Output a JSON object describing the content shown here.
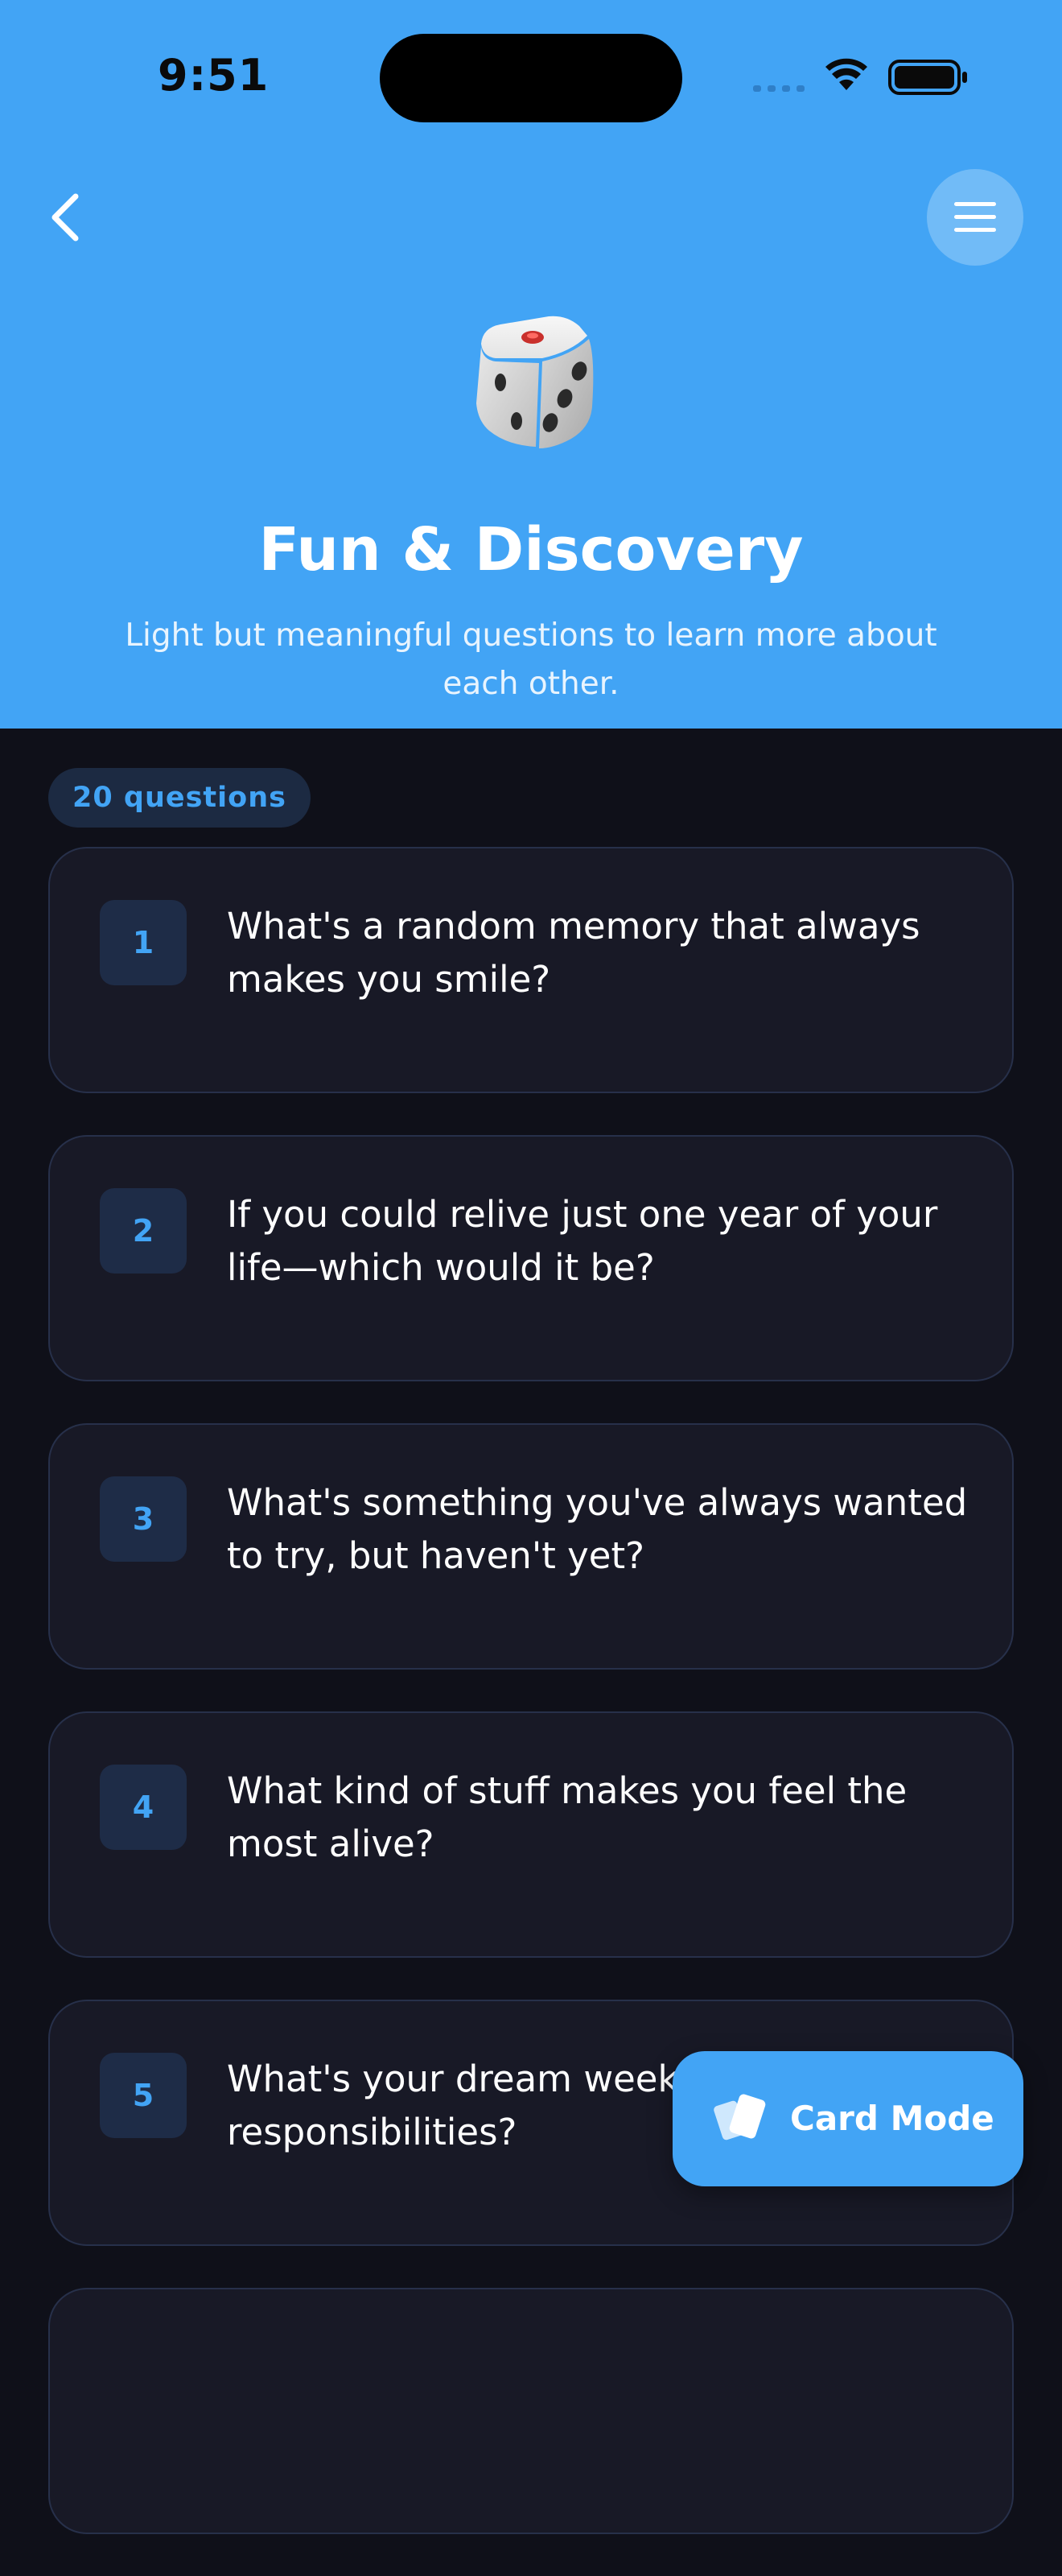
{
  "status_bar": {
    "time": "9:51"
  },
  "header": {
    "title": "Fun & Discovery",
    "subtitle": "Light but meaningful questions to learn more about each other.",
    "icons": {
      "back": "chevron-left-icon",
      "menu": "hamburger-menu-icon",
      "category": "dice-icon"
    },
    "background_color": "#42a4f5"
  },
  "question_count_label": "20 questions",
  "questions": [
    {
      "number": "1",
      "text": "What's a random memory that always makes you smile?"
    },
    {
      "number": "2",
      "text": "If you could relive just one year of your life—which would it be?"
    },
    {
      "number": "3",
      "text": "What's something you've always wanted to try, but haven't yet?"
    },
    {
      "number": "4",
      "text": "What kind of stuff makes you feel the most alive?"
    },
    {
      "number": "5",
      "text": "What's your dream weekend without responsibilities?"
    }
  ],
  "fab": {
    "label": "Card Mode",
    "icon": "cards-icon"
  },
  "colors": {
    "accent": "#42a4f5",
    "background": "#0f1019",
    "card": "#181926",
    "card_border": "#27304a"
  }
}
